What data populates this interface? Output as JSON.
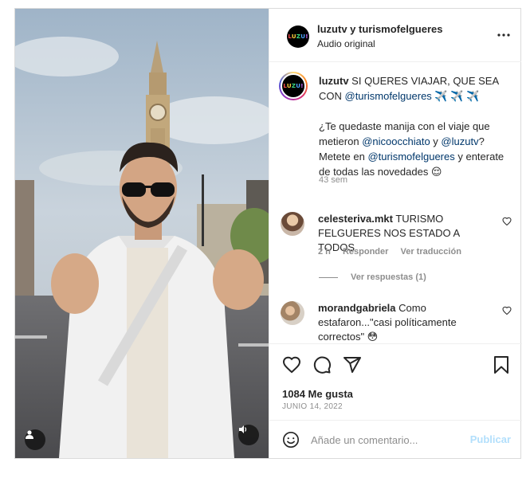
{
  "post": {
    "authors": "luzutv y turismofelgueres",
    "audio": "Audio original",
    "logo_letters": [
      "L",
      "U",
      "Z",
      "U",
      "!"
    ]
  },
  "caption": {
    "username": "luzutv",
    "line1": " SI QUERES VIAJAR, QUE SEA CON ",
    "mention1": "@turismofelgueres",
    "line1_end": " ✈️ ✈️ ✈️",
    "para2_a": "¿Te quedaste manija con el viaje que metieron ",
    "mention2": "@nicoocchiato",
    "para2_b": " y ",
    "mention3": "@luzutv",
    "para2_c": "? Metete en ",
    "mention4": "@turismofelgueres",
    "para2_d": " y enterate de todas las novedades 😌",
    "time": "43 sem"
  },
  "comments": [
    {
      "username": "celesteriva.mkt",
      "text": " TURISMO FELGUERES NOS ESTADO A TODOS",
      "time": "2 h",
      "reply_label": "Responder",
      "translate_label": "Ver traducción",
      "view_replies": "Ver respuestas (1)"
    },
    {
      "username": "morandgabriela",
      "text": " Como estafaron...\"casi políticamente correctos\" 😳"
    }
  ],
  "stats": {
    "likes": "1084 Me gusta",
    "date": "JUNIO 14, 2022"
  },
  "composer": {
    "placeholder": "Añade un comentario...",
    "post_label": "Publicar"
  },
  "icons": {
    "more": "more-options-icon",
    "like": "heart-icon",
    "comment": "comment-icon",
    "share": "send-icon",
    "save": "bookmark-icon",
    "emoji": "emoji-icon",
    "user": "user-tag-icon",
    "audio": "speaker-icon"
  },
  "colors": {
    "link": "#00376b",
    "muted": "#8e8e8e",
    "post_disabled": "#b2dffc"
  }
}
